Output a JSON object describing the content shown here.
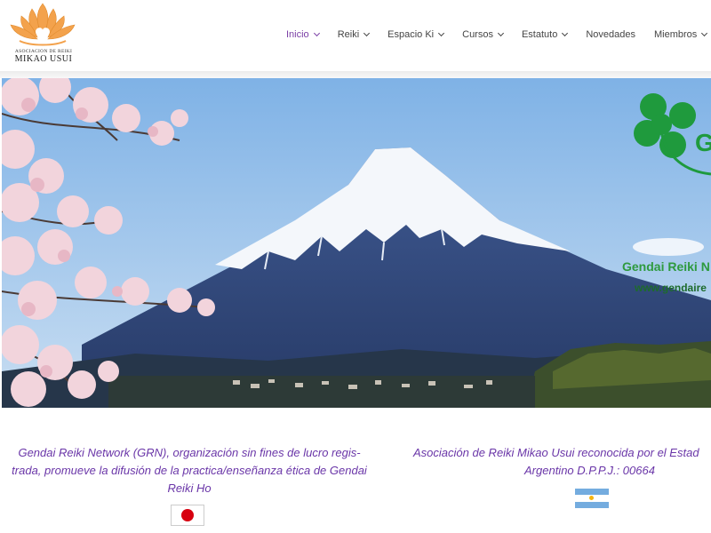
{
  "logo": {
    "subtitle": "ASOCIACION DE REIKI",
    "name": "MIKAO USUI"
  },
  "nav": {
    "items": [
      {
        "label": "Inicio",
        "dropdown": true,
        "active": true
      },
      {
        "label": "Reiki",
        "dropdown": true
      },
      {
        "label": "Espacio Ki",
        "dropdown": true
      },
      {
        "label": "Cursos",
        "dropdown": true
      },
      {
        "label": "Estatuto",
        "dropdown": true
      },
      {
        "label": "Novedades",
        "dropdown": false
      },
      {
        "label": "Miembros",
        "dropdown": true
      }
    ]
  },
  "hero": {
    "grn_tagline": "Gendai Reiki N",
    "grn_url": "www.gendaire",
    "grn_letter": "G"
  },
  "content": {
    "left_text": "Gendai Reiki Network (GRN), organización sin fines de lucro regis-trada, promueve la difusión de la practica/enseñanza ética de Gendai Reiki Ho",
    "left_lines": [
      "Gendai Reiki Network (GRN), organización sin fines de lucro regis-",
      "trada, promueve la difusión de la practica/enseñanza ética de Gendai",
      "Reiki Ho"
    ],
    "right_lines": [
      "Asociación de Reiki Mikao Usui reconocida por el Estad",
      "Argentino D.P.P.J.: 00664"
    ]
  },
  "colors": {
    "accent": "#6a36a8",
    "nav_active": "#7b3fa6",
    "grn_green": "#2e9a3e",
    "logo_orange": "#f0a04a"
  }
}
